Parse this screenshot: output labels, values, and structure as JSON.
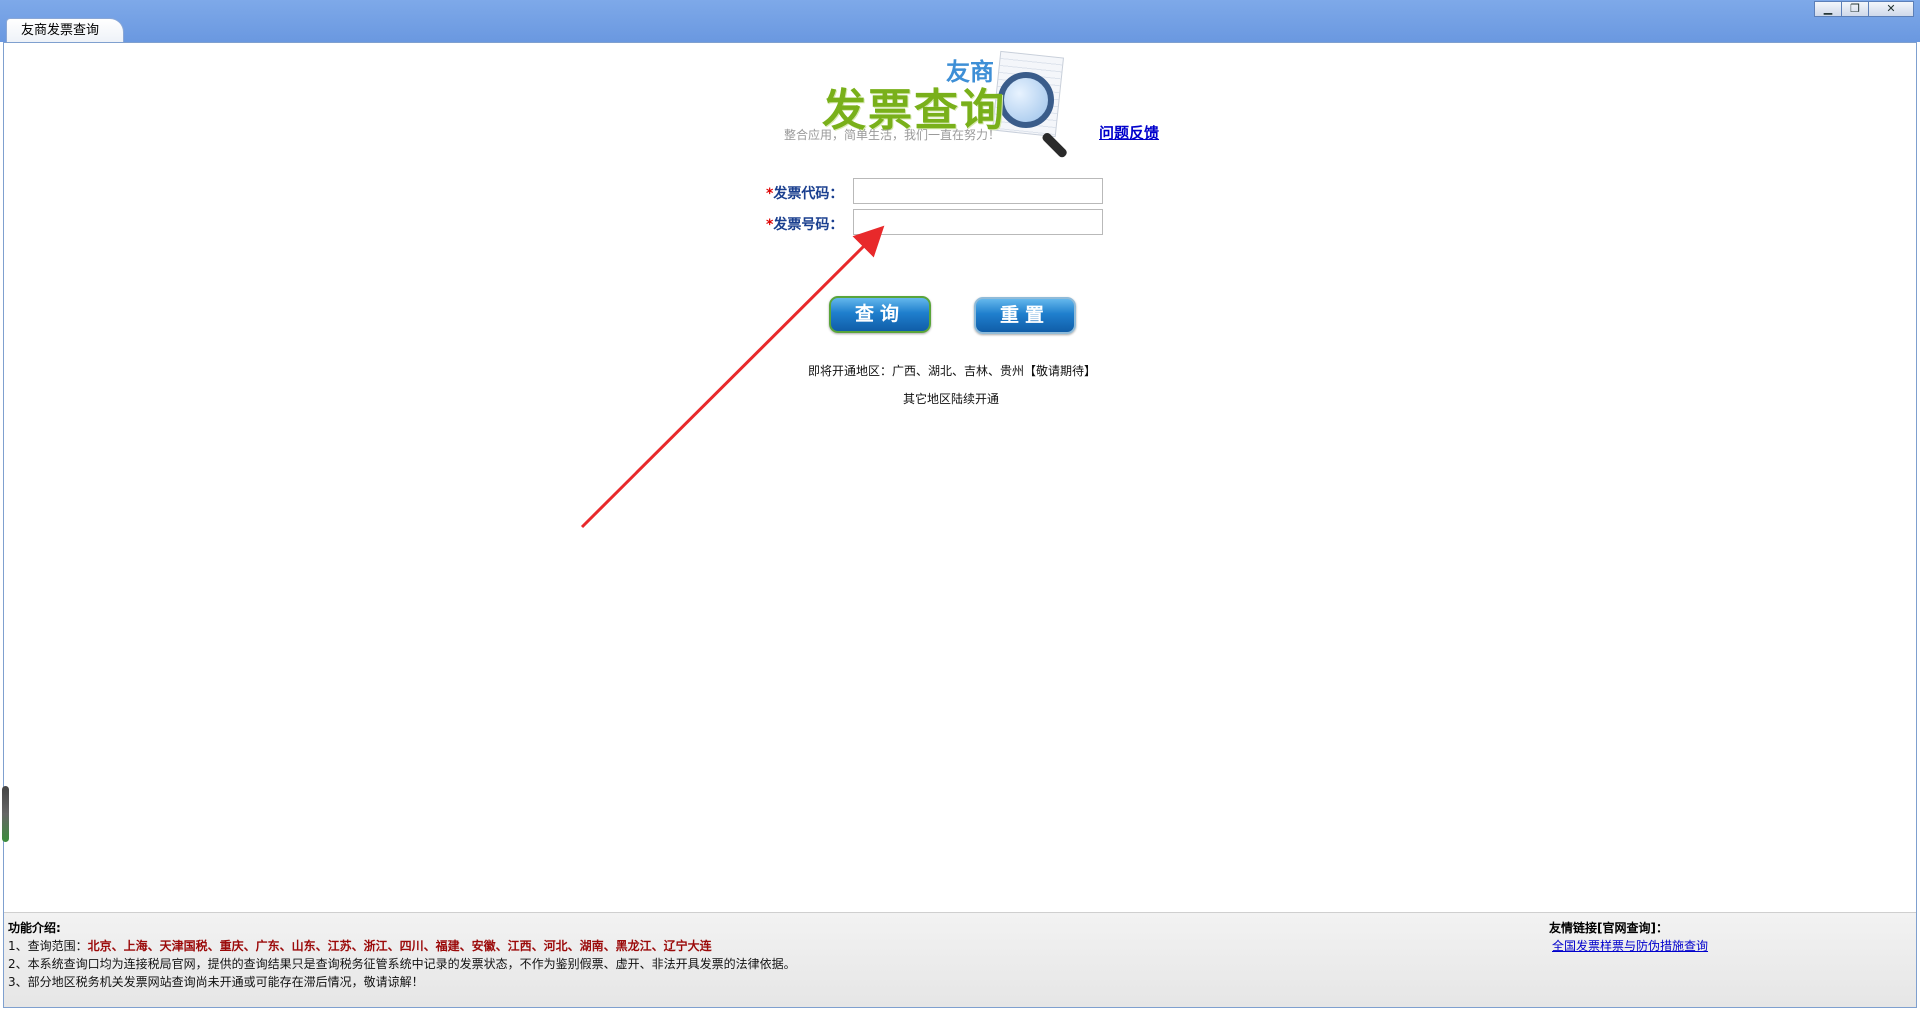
{
  "window": {
    "tab_title": "友商发票查询",
    "controls": [
      "▁",
      "❐",
      "✕"
    ]
  },
  "logo": {
    "brand": "友商",
    "title": "发票查询",
    "slogan": "整合应用，简单生活，我们一直在努力！"
  },
  "feedback_link": "问题反馈",
  "form": {
    "required_mark": "*",
    "invoice_code_label": "发票代码：",
    "invoice_code_value": "",
    "invoice_number_label": "发票号码：",
    "invoice_number_value": ""
  },
  "buttons": {
    "query": "查询",
    "reset": "重置"
  },
  "notes": {
    "upcoming": "即将开通地区：广西、湖北、吉林、贵州【敬请期待】",
    "others": "其它地区陆续开通"
  },
  "footer": {
    "title": "功能介绍:",
    "line1_prefix": "1、查询范围：",
    "line1_regions": "北京、上海、天津国税、重庆、广东、山东、江苏、浙江、四川、福建、安徽、江西、河北、湖南、黑龙江、辽宁大连",
    "line2": "2、本系统查询口均为连接税局官网，提供的查询结果只是查询税务征管系统中记录的发票状态，不作为鉴别假票、虚开、非法开具发票的法律依据。",
    "line3": "3、部分地区税务机关发票网站查询尚未开通或可能存在滞后情况，敬请谅解！",
    "links_title": "友情链接[官网查询]：",
    "link1": "全国发票样票与防伪措施查询"
  },
  "colors": {
    "titlebar": "#6a98e0",
    "label_blue": "#1a3f8f",
    "required_red": "#dd0000",
    "region_red": "#9b0a0a",
    "button_blue": "#1f7fcd",
    "annotation_arrow": "#e8292b"
  }
}
